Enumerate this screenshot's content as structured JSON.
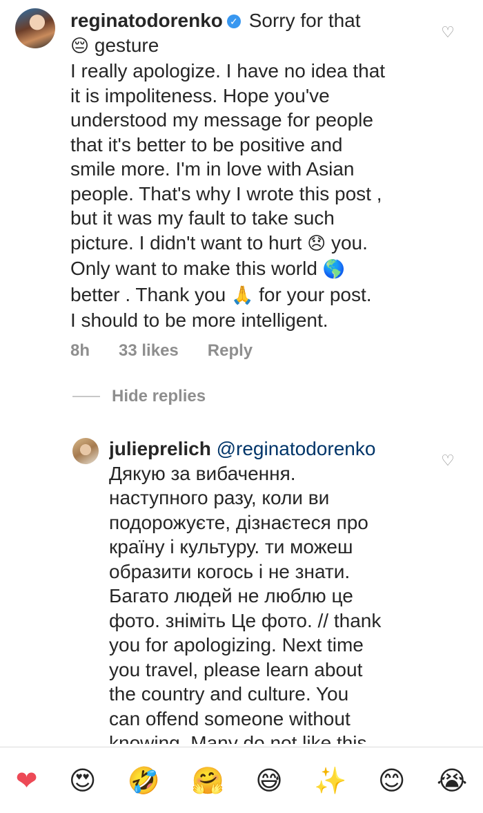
{
  "main_comment": {
    "username": "reginatodorenko",
    "verified_symbol": "✓",
    "lines": [
      "Sorry for that",
      "gesture",
      "I really apologize. I have no idea that",
      "it is impoliteness. Hope you've",
      "understood my message for people",
      "that it's better to be positive and",
      "smile more. I'm in love with Asian",
      "people. That's why I wrote this post ,",
      "but it was my fault to take such",
      "picture. I didn't want to hurt",
      "you.",
      "Only want to make this world",
      "better . Thank you",
      "for your post.",
      "I should to be  more intelligent."
    ],
    "emojis": {
      "pensive": "😔",
      "disappointed": "😞",
      "globe": "🌎",
      "pray": "🙏"
    },
    "time": "8h",
    "likes": "33 likes",
    "reply": "Reply"
  },
  "hide_replies": "Hide replies",
  "reply_comment": {
    "username": "julieprelich",
    "mention": "@reginatodorenko",
    "lines": [
      "Дякую за вибачення.",
      "наступного разу, коли ви",
      "подорожуєте, дізнаєтеся про",
      "країну і культуру. ти можеш",
      "образити когось і не знати.",
      "Багато людей не люблю це",
      "фото. зніміть Це фото. // thank",
      "you for apologizing. Next time",
      "you travel, please learn about",
      "the country and culture. You",
      "can offend someone without",
      "knowing. Many do not like this"
    ]
  },
  "like_icon": "♡",
  "reactions": [
    "❤",
    "😍",
    "🤣",
    "🤗",
    "😅",
    "✨",
    "😊",
    "😭"
  ],
  "colors": {
    "text": "#262626",
    "muted": "#8e8e8e",
    "verified": "#3897f0",
    "heart": "#ed4956",
    "mention": "#003569"
  }
}
